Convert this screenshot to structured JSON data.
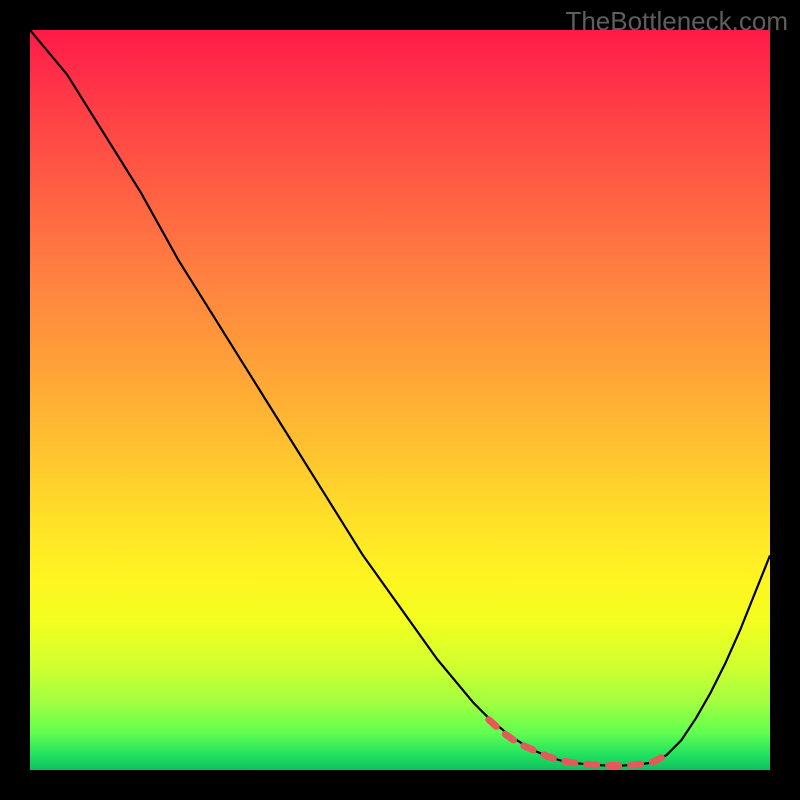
{
  "watermark": "TheBottleneck.com",
  "chart_data": {
    "type": "line",
    "title": "",
    "xlabel": "",
    "ylabel": "",
    "xlim": [
      0,
      100
    ],
    "ylim": [
      0,
      100
    ],
    "grid": false,
    "series": [
      {
        "name": "curve",
        "color": "#000000",
        "x": [
          0,
          5,
          10,
          15,
          20,
          25,
          30,
          35,
          40,
          45,
          50,
          55,
          60,
          62,
          65,
          68,
          70,
          72,
          74,
          76,
          78,
          80,
          82,
          84,
          86,
          88,
          90,
          92,
          94,
          96,
          98,
          100
        ],
        "y": [
          100,
          94,
          86,
          78,
          69,
          61,
          53,
          45,
          37,
          29,
          22,
          15,
          9,
          7,
          4.5,
          2.7,
          1.8,
          1.2,
          0.9,
          0.7,
          0.6,
          0.6,
          0.7,
          1.0,
          2.0,
          4.0,
          7.0,
          10.5,
          14.5,
          19.0,
          24.0,
          29.0
        ]
      },
      {
        "name": "highlight",
        "color": "#e45a5a",
        "type": "segment",
        "x": [
          62,
          64,
          66,
          68,
          70,
          72,
          74,
          76,
          78,
          80,
          82,
          84,
          86
        ],
        "y": [
          6.8,
          5.0,
          3.6,
          2.7,
          1.8,
          1.2,
          0.9,
          0.7,
          0.6,
          0.6,
          0.7,
          1.0,
          2.0
        ]
      }
    ],
    "background_gradient": {
      "top": "#ff1a47",
      "mid": "#ffe028",
      "bottom": "#10c060"
    }
  }
}
